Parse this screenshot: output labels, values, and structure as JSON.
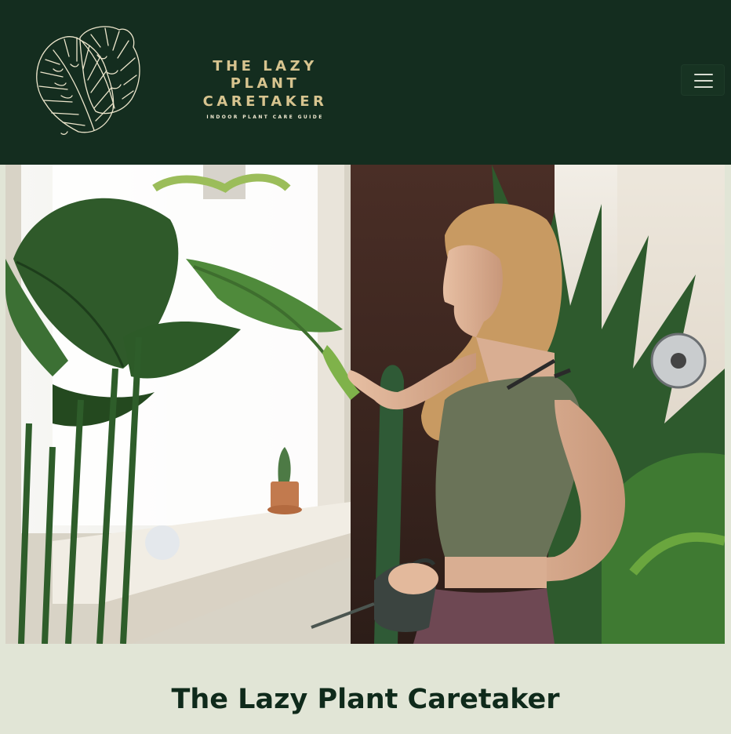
{
  "header": {
    "logo": {
      "icon": "monstera-leaf-icon",
      "title_line1": "THE LAZY PLANT",
      "title_line2": "CARETAKER",
      "tagline": "INDOOR PLANT CARE GUIDE",
      "color": "#d7c48f"
    },
    "menu_button": {
      "icon": "hamburger-menu-icon"
    },
    "background": "#142d1f"
  },
  "hero": {
    "image": "woman-watering-houseplants-photo"
  },
  "main": {
    "title": "The Lazy Plant Caretaker"
  },
  "colors": {
    "page_background": "#e1e5d6",
    "title_text": "#0f2a1b"
  }
}
